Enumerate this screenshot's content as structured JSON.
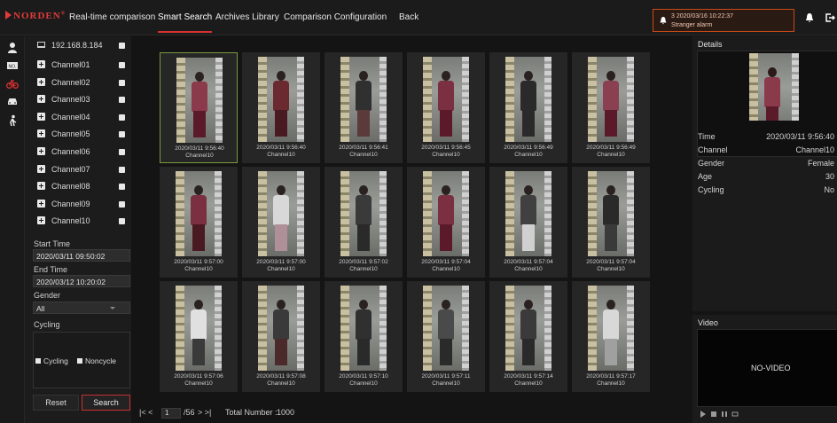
{
  "brand": {
    "logo_text": "NORDEN",
    "logo_mark": "®",
    "accent": "#d83030"
  },
  "nav": [
    {
      "label": "Real-time comparison",
      "active": false
    },
    {
      "label": "Smart Search",
      "active": true
    },
    {
      "label": "Archives Library",
      "active": false
    },
    {
      "label": "Comparison Configuration",
      "active": false
    },
    {
      "label": "Back",
      "active": false
    }
  ],
  "alarm": {
    "time": "3 2020/03/16 10:22:37",
    "message": "Stranger alarm",
    "border_color": "#c84a18"
  },
  "device": {
    "ip": "192.168.8.184"
  },
  "channels": [
    "Channel01",
    "Channel02",
    "Channel03",
    "Channel04",
    "Channel05",
    "Channel06",
    "Channel07",
    "Channel08",
    "Channel09",
    "Channel10"
  ],
  "filters": {
    "start_time_label": "Start Time",
    "start_time": "2020/03/11 09:50:02",
    "end_time_label": "End Time",
    "end_time": "2020/03/12 10:20:02",
    "gender_label": "Gender",
    "gender_value": "All",
    "cycling_label": "Cycling",
    "cycling_option": "Cycling",
    "noncycle_option": "Noncycle",
    "reset_label": "Reset",
    "search_label": "Search"
  },
  "results": [
    {
      "time": "2020/03/11 9:56:40",
      "channel": "Channel10",
      "top": "#8a3a4a",
      "bottom": "#5a1a2a",
      "selected": true
    },
    {
      "time": "2020/03/11 9:56:40",
      "channel": "Channel10",
      "top": "#6a2a30",
      "bottom": "#4a1a22",
      "selected": false
    },
    {
      "time": "2020/03/11 9:56:41",
      "channel": "Channel10",
      "top": "#303030",
      "bottom": "#5a3a3a",
      "selected": false
    },
    {
      "time": "2020/03/11 9:56:45",
      "channel": "Channel10",
      "top": "#7a3040",
      "bottom": "#5a1a2a",
      "selected": false
    },
    {
      "time": "2020/03/11 9:56:49",
      "channel": "Channel10",
      "top": "#2a2a2a",
      "bottom": "#2a2a2a",
      "selected": false
    },
    {
      "time": "2020/03/11 9:56:49",
      "channel": "Channel10",
      "top": "#8a4050",
      "bottom": "#5a1a2a",
      "selected": false
    },
    {
      "time": "2020/03/11 9:57:00",
      "channel": "Channel10",
      "top": "#7a3040",
      "bottom": "#4a1a22",
      "selected": false
    },
    {
      "time": "2020/03/11 9:57:00",
      "channel": "Channel10",
      "top": "#d8d8d8",
      "bottom": "#b09098",
      "selected": false
    },
    {
      "time": "2020/03/11 9:57:02",
      "channel": "Channel10",
      "top": "#3a3a3a",
      "bottom": "#2a2a2a",
      "selected": false
    },
    {
      "time": "2020/03/11 9:57:04",
      "channel": "Channel10",
      "top": "#7a3040",
      "bottom": "#5a1a2a",
      "selected": false
    },
    {
      "time": "2020/03/11 9:57:04",
      "channel": "Channel10",
      "top": "#404040",
      "bottom": "#d0d0d0",
      "selected": false
    },
    {
      "time": "2020/03/11 9:57:04",
      "channel": "Channel10",
      "top": "#2a2a2a",
      "bottom": "#3a3a3a",
      "selected": false
    },
    {
      "time": "2020/03/11 9:57:06",
      "channel": "Channel10",
      "top": "#e0e0e0",
      "bottom": "#3a3a3a",
      "selected": false
    },
    {
      "time": "2020/03/11 9:57:08",
      "channel": "Channel10",
      "top": "#3a3a3a",
      "bottom": "#4a2a2a",
      "selected": false
    },
    {
      "time": "2020/03/11 9:57:10",
      "channel": "Channel10",
      "top": "#303030",
      "bottom": "#2a2a2a",
      "selected": false
    },
    {
      "time": "2020/03/11 9:57:11",
      "channel": "Channel10",
      "top": "#4a4a4a",
      "bottom": "#2a2a2a",
      "selected": false
    },
    {
      "time": "2020/03/11 9:57:14",
      "channel": "Channel10",
      "top": "#3a3a3a",
      "bottom": "#2a2a2a",
      "selected": false
    },
    {
      "time": "2020/03/11 9:57:17",
      "channel": "Channel10",
      "top": "#d8d8d8",
      "bottom": "#a0a0a0",
      "selected": false
    }
  ],
  "pager": {
    "prev_glyph": "|< <",
    "current_page": "1",
    "total_pages": "/56",
    "next_glyph": "> >|",
    "total_label": "Total Number :",
    "total_value": "1000"
  },
  "details": {
    "title": "Details",
    "rows": [
      {
        "label": "Time",
        "value": "2020/03/11 9:56:40"
      },
      {
        "label": "Channel",
        "value": "Channel10"
      },
      {
        "label": "Gender",
        "value": "Female"
      },
      {
        "label": "Age",
        "value": "30"
      },
      {
        "label": "Cycling",
        "value": "No"
      }
    ]
  },
  "video": {
    "title": "Video",
    "status": "NO-VIDEO"
  }
}
